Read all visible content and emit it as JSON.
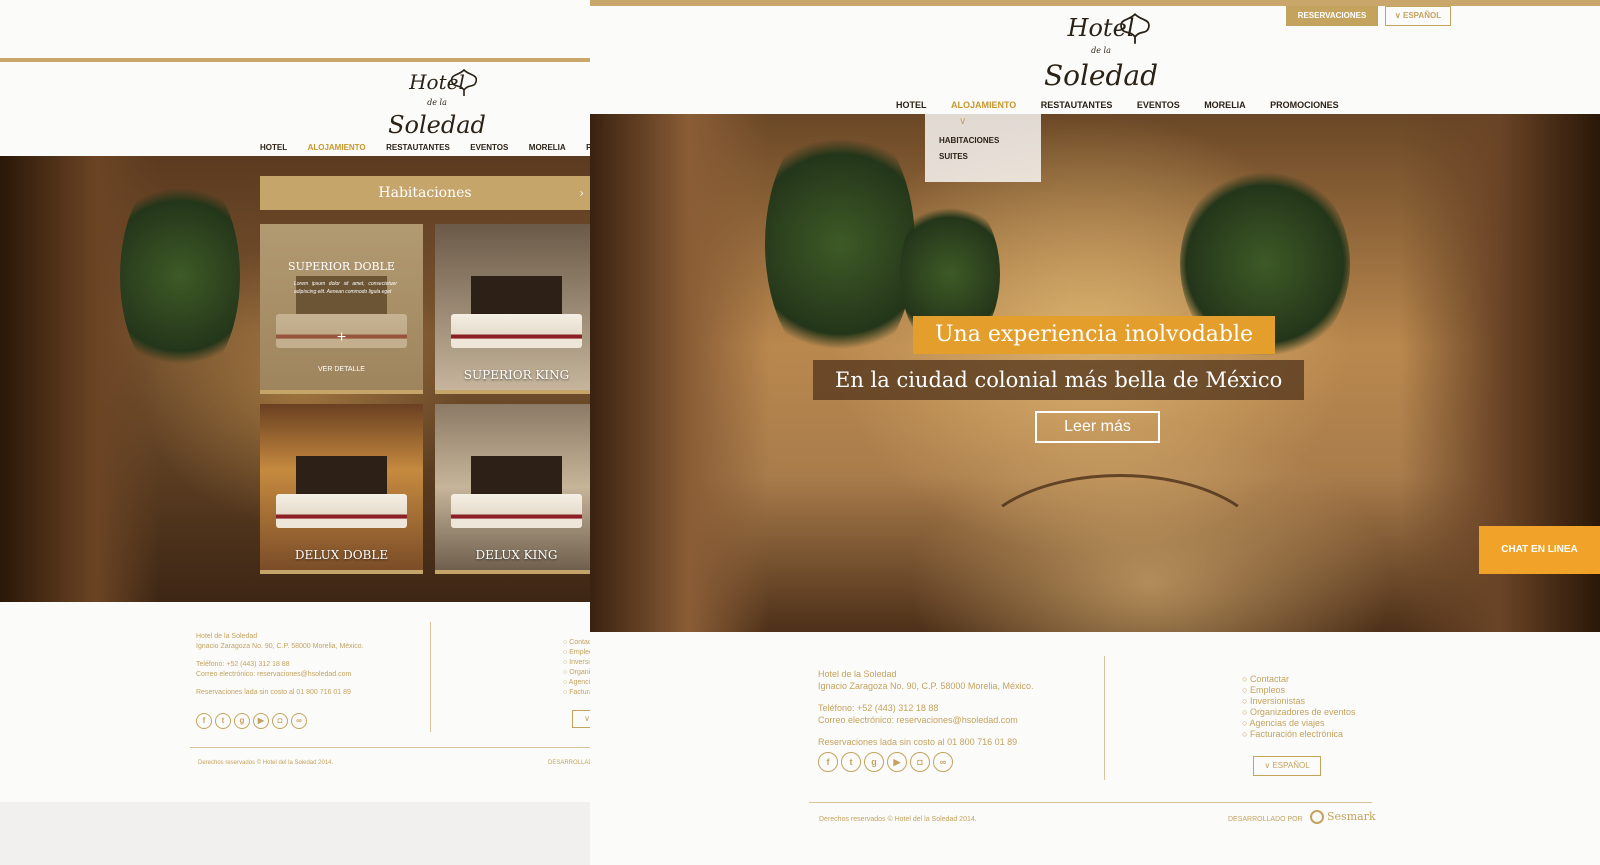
{
  "brand": {
    "line1": "Hotel",
    "line2": "de la",
    "line3": "Soledad"
  },
  "nav": [
    "HOTEL",
    "ALOJAMIENTO",
    "RESTAUTANTES",
    "EVENTOS",
    "MORELIA",
    "PROMOCIONES"
  ],
  "nav_active": "ALOJAMIENTO",
  "top_bar": {
    "reservaciones": "RESERVACIONES",
    "idioma": "ESPAÑOL"
  },
  "dropdown": {
    "items": [
      "HABITACIONES",
      "SUITES"
    ]
  },
  "hero": {
    "tagline": "Una experiencia inolvodable",
    "subtitle": "En la ciudad colonial más bella de México",
    "cta": "Leer más"
  },
  "chat": "CHAT EN LINEA",
  "rooms_panel": {
    "header": "Habitaciones",
    "rooms": [
      {
        "name": "SUPERIOR DOBLE",
        "desc": "Lorem ipsum dolor sit amet, consectetuer adipiscing elit. Aenean commodo ligula eget",
        "detail": "VER DETALLE"
      },
      {
        "name": "SUPERIOR KING"
      },
      {
        "name": "DELUX DOBLE"
      },
      {
        "name": "DELUX KING"
      }
    ]
  },
  "footer": {
    "name": "Hotel de la Soledad",
    "address": "Ignacio Zaragoza No. 90, C.P. 58000 Morelia, México.",
    "phone": "Teléfono: +52 (443) 312 18 88",
    "email": "Correo electrónico: reservaciones@hsoledad.com",
    "tollfree": "Reservaciones lada sin costo al  01 800 716 01 89",
    "links": [
      "Contactar",
      "Empleos",
      "Inversionistas",
      "Organizadores de eventos",
      "Agencias de viajes",
      "Facturación electrónica"
    ],
    "language": "ESPAÑOL",
    "copyright": "Derechos reservados © Hotel del la Soledad 2014.",
    "developed_by": "DESARROLLADO POR",
    "developer": "Sesmark"
  },
  "social_icons": [
    "facebook-icon",
    "twitter-icon",
    "googleplus-icon",
    "youtube-icon",
    "instagram-icon",
    "tripadvisor-icon"
  ],
  "colors": {
    "gold": "#c4a35f",
    "orange": "#e39e2c",
    "chat": "#f0a229",
    "dark": "#2b2216"
  }
}
